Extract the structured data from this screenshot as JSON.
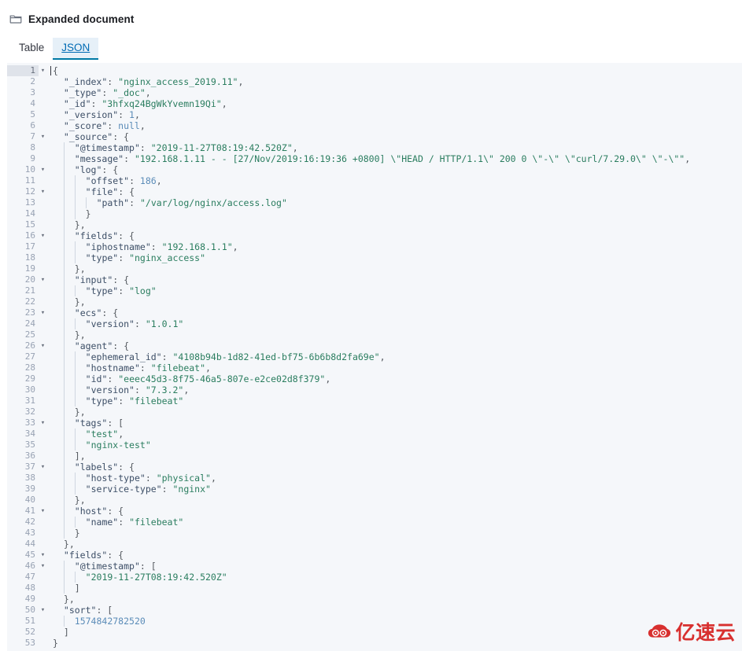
{
  "header": {
    "icon": "folder-icon",
    "title": "Expanded document"
  },
  "tabs": [
    {
      "id": "table",
      "label": "Table",
      "active": false
    },
    {
      "id": "json",
      "label": "JSON",
      "active": true
    }
  ],
  "editor": {
    "active_line": 1,
    "colors": {
      "background": "#f5f7fa",
      "gutter_text": "#98a2b3",
      "active_gutter_bg": "#dfe3ea",
      "key": "#3c4e66",
      "string": "#2a7d5f",
      "number": "#5b8cb8",
      "punctuation": "#54595f",
      "indent_guide": "#cfd6e0",
      "tab_active_accent": "#0079a5"
    },
    "lines": [
      {
        "num": 1,
        "fold": true,
        "indent": 0,
        "tokens": [
          {
            "t": "p",
            "v": "{"
          }
        ]
      },
      {
        "num": 2,
        "fold": false,
        "indent": 1,
        "tokens": [
          {
            "t": "k",
            "v": "\"_index\""
          },
          {
            "t": "p",
            "v": ": "
          },
          {
            "t": "s",
            "v": "\"nginx_access_2019.11\""
          },
          {
            "t": "p",
            "v": ","
          }
        ]
      },
      {
        "num": 3,
        "fold": false,
        "indent": 1,
        "tokens": [
          {
            "t": "k",
            "v": "\"_type\""
          },
          {
            "t": "p",
            "v": ": "
          },
          {
            "t": "s",
            "v": "\"_doc\""
          },
          {
            "t": "p",
            "v": ","
          }
        ]
      },
      {
        "num": 4,
        "fold": false,
        "indent": 1,
        "tokens": [
          {
            "t": "k",
            "v": "\"_id\""
          },
          {
            "t": "p",
            "v": ": "
          },
          {
            "t": "s",
            "v": "\"3hfxq24BgWkYvemn19Qi\""
          },
          {
            "t": "p",
            "v": ","
          }
        ]
      },
      {
        "num": 5,
        "fold": false,
        "indent": 1,
        "tokens": [
          {
            "t": "k",
            "v": "\"_version\""
          },
          {
            "t": "p",
            "v": ": "
          },
          {
            "t": "n",
            "v": "1"
          },
          {
            "t": "p",
            "v": ","
          }
        ]
      },
      {
        "num": 6,
        "fold": false,
        "indent": 1,
        "tokens": [
          {
            "t": "k",
            "v": "\"_score\""
          },
          {
            "t": "p",
            "v": ": "
          },
          {
            "t": "n",
            "v": "null"
          },
          {
            "t": "p",
            "v": ","
          }
        ]
      },
      {
        "num": 7,
        "fold": true,
        "indent": 1,
        "tokens": [
          {
            "t": "k",
            "v": "\"_source\""
          },
          {
            "t": "p",
            "v": ": {"
          }
        ]
      },
      {
        "num": 8,
        "fold": false,
        "indent": 2,
        "tokens": [
          {
            "t": "k",
            "v": "\"@timestamp\""
          },
          {
            "t": "p",
            "v": ": "
          },
          {
            "t": "s",
            "v": "\"2019-11-27T08:19:42.520Z\""
          },
          {
            "t": "p",
            "v": ","
          }
        ]
      },
      {
        "num": 9,
        "fold": false,
        "indent": 2,
        "tokens": [
          {
            "t": "k",
            "v": "\"message\""
          },
          {
            "t": "p",
            "v": ": "
          },
          {
            "t": "s",
            "v": "\"192.168.1.11 - - [27/Nov/2019:16:19:36 +0800] \\\"HEAD / HTTP/1.1\\\" 200 0 \\\"-\\\" \\\"curl/7.29.0\\\" \\\"-\\\"\""
          },
          {
            "t": "p",
            "v": ","
          }
        ]
      },
      {
        "num": 10,
        "fold": true,
        "indent": 2,
        "tokens": [
          {
            "t": "k",
            "v": "\"log\""
          },
          {
            "t": "p",
            "v": ": {"
          }
        ]
      },
      {
        "num": 11,
        "fold": false,
        "indent": 3,
        "tokens": [
          {
            "t": "k",
            "v": "\"offset\""
          },
          {
            "t": "p",
            "v": ": "
          },
          {
            "t": "n",
            "v": "186"
          },
          {
            "t": "p",
            "v": ","
          }
        ]
      },
      {
        "num": 12,
        "fold": true,
        "indent": 3,
        "tokens": [
          {
            "t": "k",
            "v": "\"file\""
          },
          {
            "t": "p",
            "v": ": {"
          }
        ]
      },
      {
        "num": 13,
        "fold": false,
        "indent": 4,
        "tokens": [
          {
            "t": "k",
            "v": "\"path\""
          },
          {
            "t": "p",
            "v": ": "
          },
          {
            "t": "s",
            "v": "\"/var/log/nginx/access.log\""
          }
        ]
      },
      {
        "num": 14,
        "fold": false,
        "indent": 3,
        "tokens": [
          {
            "t": "p",
            "v": "}"
          }
        ]
      },
      {
        "num": 15,
        "fold": false,
        "indent": 2,
        "tokens": [
          {
            "t": "p",
            "v": "},"
          }
        ]
      },
      {
        "num": 16,
        "fold": true,
        "indent": 2,
        "tokens": [
          {
            "t": "k",
            "v": "\"fields\""
          },
          {
            "t": "p",
            "v": ": {"
          }
        ]
      },
      {
        "num": 17,
        "fold": false,
        "indent": 3,
        "tokens": [
          {
            "t": "k",
            "v": "\"iphostname\""
          },
          {
            "t": "p",
            "v": ": "
          },
          {
            "t": "s",
            "v": "\"192.168.1.1\""
          },
          {
            "t": "p",
            "v": ","
          }
        ]
      },
      {
        "num": 18,
        "fold": false,
        "indent": 3,
        "tokens": [
          {
            "t": "k",
            "v": "\"type\""
          },
          {
            "t": "p",
            "v": ": "
          },
          {
            "t": "s",
            "v": "\"nginx_access\""
          }
        ]
      },
      {
        "num": 19,
        "fold": false,
        "indent": 2,
        "tokens": [
          {
            "t": "p",
            "v": "},"
          }
        ]
      },
      {
        "num": 20,
        "fold": true,
        "indent": 2,
        "tokens": [
          {
            "t": "k",
            "v": "\"input\""
          },
          {
            "t": "p",
            "v": ": {"
          }
        ]
      },
      {
        "num": 21,
        "fold": false,
        "indent": 3,
        "tokens": [
          {
            "t": "k",
            "v": "\"type\""
          },
          {
            "t": "p",
            "v": ": "
          },
          {
            "t": "s",
            "v": "\"log\""
          }
        ]
      },
      {
        "num": 22,
        "fold": false,
        "indent": 2,
        "tokens": [
          {
            "t": "p",
            "v": "},"
          }
        ]
      },
      {
        "num": 23,
        "fold": true,
        "indent": 2,
        "tokens": [
          {
            "t": "k",
            "v": "\"ecs\""
          },
          {
            "t": "p",
            "v": ": {"
          }
        ]
      },
      {
        "num": 24,
        "fold": false,
        "indent": 3,
        "tokens": [
          {
            "t": "k",
            "v": "\"version\""
          },
          {
            "t": "p",
            "v": ": "
          },
          {
            "t": "s",
            "v": "\"1.0.1\""
          }
        ]
      },
      {
        "num": 25,
        "fold": false,
        "indent": 2,
        "tokens": [
          {
            "t": "p",
            "v": "},"
          }
        ]
      },
      {
        "num": 26,
        "fold": true,
        "indent": 2,
        "tokens": [
          {
            "t": "k",
            "v": "\"agent\""
          },
          {
            "t": "p",
            "v": ": {"
          }
        ]
      },
      {
        "num": 27,
        "fold": false,
        "indent": 3,
        "tokens": [
          {
            "t": "k",
            "v": "\"ephemeral_id\""
          },
          {
            "t": "p",
            "v": ": "
          },
          {
            "t": "s",
            "v": "\"4108b94b-1d82-41ed-bf75-6b6b8d2fa69e\""
          },
          {
            "t": "p",
            "v": ","
          }
        ]
      },
      {
        "num": 28,
        "fold": false,
        "indent": 3,
        "tokens": [
          {
            "t": "k",
            "v": "\"hostname\""
          },
          {
            "t": "p",
            "v": ": "
          },
          {
            "t": "s",
            "v": "\"filebeat\""
          },
          {
            "t": "p",
            "v": ","
          }
        ]
      },
      {
        "num": 29,
        "fold": false,
        "indent": 3,
        "tokens": [
          {
            "t": "k",
            "v": "\"id\""
          },
          {
            "t": "p",
            "v": ": "
          },
          {
            "t": "s",
            "v": "\"eeec45d3-8f75-46a5-807e-e2ce02d8f379\""
          },
          {
            "t": "p",
            "v": ","
          }
        ]
      },
      {
        "num": 30,
        "fold": false,
        "indent": 3,
        "tokens": [
          {
            "t": "k",
            "v": "\"version\""
          },
          {
            "t": "p",
            "v": ": "
          },
          {
            "t": "s",
            "v": "\"7.3.2\""
          },
          {
            "t": "p",
            "v": ","
          }
        ]
      },
      {
        "num": 31,
        "fold": false,
        "indent": 3,
        "tokens": [
          {
            "t": "k",
            "v": "\"type\""
          },
          {
            "t": "p",
            "v": ": "
          },
          {
            "t": "s",
            "v": "\"filebeat\""
          }
        ]
      },
      {
        "num": 32,
        "fold": false,
        "indent": 2,
        "tokens": [
          {
            "t": "p",
            "v": "},"
          }
        ]
      },
      {
        "num": 33,
        "fold": true,
        "indent": 2,
        "tokens": [
          {
            "t": "k",
            "v": "\"tags\""
          },
          {
            "t": "p",
            "v": ": ["
          }
        ]
      },
      {
        "num": 34,
        "fold": false,
        "indent": 3,
        "tokens": [
          {
            "t": "s",
            "v": "\"test\""
          },
          {
            "t": "p",
            "v": ","
          }
        ]
      },
      {
        "num": 35,
        "fold": false,
        "indent": 3,
        "tokens": [
          {
            "t": "s",
            "v": "\"nginx-test\""
          }
        ]
      },
      {
        "num": 36,
        "fold": false,
        "indent": 2,
        "tokens": [
          {
            "t": "p",
            "v": "],"
          }
        ]
      },
      {
        "num": 37,
        "fold": true,
        "indent": 2,
        "tokens": [
          {
            "t": "k",
            "v": "\"labels\""
          },
          {
            "t": "p",
            "v": ": {"
          }
        ]
      },
      {
        "num": 38,
        "fold": false,
        "indent": 3,
        "tokens": [
          {
            "t": "k",
            "v": "\"host-type\""
          },
          {
            "t": "p",
            "v": ": "
          },
          {
            "t": "s",
            "v": "\"physical\""
          },
          {
            "t": "p",
            "v": ","
          }
        ]
      },
      {
        "num": 39,
        "fold": false,
        "indent": 3,
        "tokens": [
          {
            "t": "k",
            "v": "\"service-type\""
          },
          {
            "t": "p",
            "v": ": "
          },
          {
            "t": "s",
            "v": "\"nginx\""
          }
        ]
      },
      {
        "num": 40,
        "fold": false,
        "indent": 2,
        "tokens": [
          {
            "t": "p",
            "v": "},"
          }
        ]
      },
      {
        "num": 41,
        "fold": true,
        "indent": 2,
        "tokens": [
          {
            "t": "k",
            "v": "\"host\""
          },
          {
            "t": "p",
            "v": ": {"
          }
        ]
      },
      {
        "num": 42,
        "fold": false,
        "indent": 3,
        "tokens": [
          {
            "t": "k",
            "v": "\"name\""
          },
          {
            "t": "p",
            "v": ": "
          },
          {
            "t": "s",
            "v": "\"filebeat\""
          }
        ]
      },
      {
        "num": 43,
        "fold": false,
        "indent": 2,
        "tokens": [
          {
            "t": "p",
            "v": "}"
          }
        ]
      },
      {
        "num": 44,
        "fold": false,
        "indent": 1,
        "tokens": [
          {
            "t": "p",
            "v": "},"
          }
        ]
      },
      {
        "num": 45,
        "fold": true,
        "indent": 1,
        "tokens": [
          {
            "t": "k",
            "v": "\"fields\""
          },
          {
            "t": "p",
            "v": ": {"
          }
        ]
      },
      {
        "num": 46,
        "fold": true,
        "indent": 2,
        "tokens": [
          {
            "t": "k",
            "v": "\"@timestamp\""
          },
          {
            "t": "p",
            "v": ": ["
          }
        ]
      },
      {
        "num": 47,
        "fold": false,
        "indent": 3,
        "tokens": [
          {
            "t": "s",
            "v": "\"2019-11-27T08:19:42.520Z\""
          }
        ]
      },
      {
        "num": 48,
        "fold": false,
        "indent": 2,
        "tokens": [
          {
            "t": "p",
            "v": "]"
          }
        ]
      },
      {
        "num": 49,
        "fold": false,
        "indent": 1,
        "tokens": [
          {
            "t": "p",
            "v": "},"
          }
        ]
      },
      {
        "num": 50,
        "fold": true,
        "indent": 1,
        "tokens": [
          {
            "t": "k",
            "v": "\"sort\""
          },
          {
            "t": "p",
            "v": ": ["
          }
        ]
      },
      {
        "num": 51,
        "fold": false,
        "indent": 2,
        "tokens": [
          {
            "t": "n",
            "v": "1574842782520"
          }
        ]
      },
      {
        "num": 52,
        "fold": false,
        "indent": 1,
        "tokens": [
          {
            "t": "p",
            "v": "]"
          }
        ]
      },
      {
        "num": 53,
        "fold": false,
        "indent": 0,
        "tokens": [
          {
            "t": "p",
            "v": "}"
          }
        ]
      }
    ]
  },
  "watermark": {
    "text": "亿速云",
    "color": "#d8302f"
  }
}
